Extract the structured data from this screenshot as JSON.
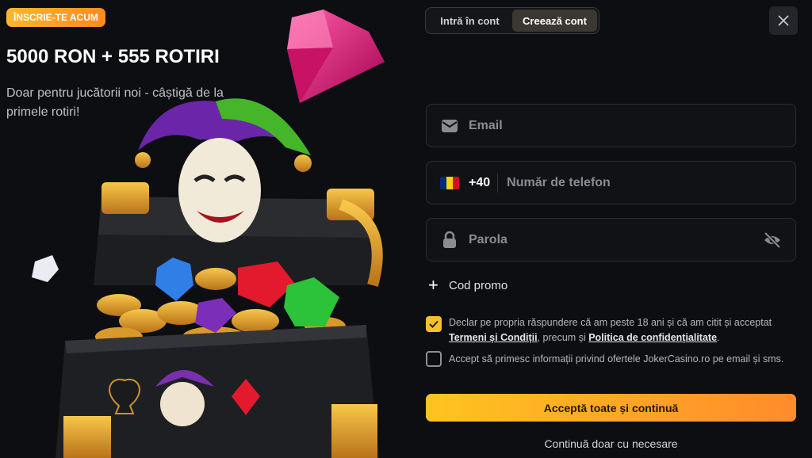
{
  "promo": {
    "badge": "ÎNSCRIE-TE ACUM",
    "headline": "5000 RON + 555 ROTIRI",
    "subline": "Doar pentru jucătorii noi - câștigă de la primele rotiri!"
  },
  "tabs": [
    {
      "label": "Intră în cont",
      "active": false
    },
    {
      "label": "Creează cont",
      "active": true
    }
  ],
  "close_icon": "close-icon",
  "form": {
    "email": {
      "placeholder": "Email",
      "value": "",
      "icon": "envelope-icon"
    },
    "phone": {
      "prefix": "+40",
      "placeholder": "Număr de telefon",
      "value": "",
      "flag": [
        "#002b7f",
        "#fcd116",
        "#ce1126"
      ]
    },
    "password": {
      "placeholder": "Parola",
      "value": "",
      "icon": "lock-icon",
      "toggle_icon": "eye-off-icon"
    },
    "promo_code": {
      "icon": "plus-icon",
      "label": "Cod promo"
    },
    "terms": {
      "checked": true,
      "text_before": "Declar pe propria răspundere că am peste 18 ani și că am citit și acceptat ",
      "link1": "Termeni și Condiții",
      "text_middle": ", precum și ",
      "link2": "Politica de confidențialitate",
      "text_after": "."
    },
    "marketing": {
      "checked": false,
      "text": "Accept să primesc informații privind ofertele JokerCasino.ro pe email și sms."
    },
    "cta_label": "Acceptă toate și continuă",
    "secondary_label": "Continuă doar cu necesare"
  },
  "colors": {
    "accent": "#f5c02a",
    "cta_start": "#ffc41f",
    "cta_end": "#ff8b2c",
    "background": "#0d0e12"
  }
}
